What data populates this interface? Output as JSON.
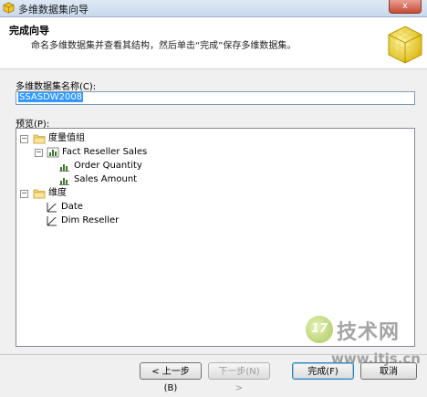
{
  "window": {
    "title": "多维数据集向导",
    "close_glyph": "x"
  },
  "header": {
    "title": "完成向导",
    "description": "命名多维数据集并查看其结构，然后单击“完成”保存多维数据集。"
  },
  "cube_name": {
    "label": "多维数据集名称(C):",
    "value": "SSASDW2008"
  },
  "preview": {
    "label": "预览(P):",
    "tree": {
      "measure_groups": {
        "label": "度量值组",
        "group": {
          "label": "Fact Reseller Sales",
          "measures": [
            "Order Quantity",
            "Sales Amount"
          ]
        }
      },
      "dimensions": {
        "label": "维度",
        "items": [
          "Date",
          "Dim Reseller"
        ]
      }
    }
  },
  "buttons": {
    "back": "< 上一步(B)",
    "next": "下一步(N) >",
    "finish": "完成(F)",
    "cancel": "取消"
  },
  "watermark": {
    "logo_text": "17",
    "brand": "技术网",
    "url": "www.itjs.cn"
  }
}
